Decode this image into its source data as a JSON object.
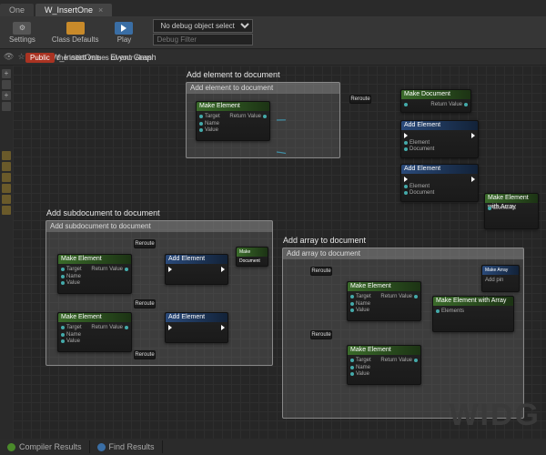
{
  "tabs": [
    {
      "label": "One",
      "active": false
    },
    {
      "label": "W_InsertOne",
      "active": true
    }
  ],
  "toolbar": {
    "settings_label": "Settings",
    "class_defaults_label": "Class Defaults",
    "play_label": "Play",
    "debug_object_placeholder": "No debug object selected",
    "debug_filter_placeholder": "Debug Filter"
  },
  "hint": {
    "button_label": "Public",
    "text": "the initial values of your class"
  },
  "breadcrumb": {
    "asset": "W_InsertOne",
    "graph": "Event Graph"
  },
  "comments": {
    "c1": {
      "title": "Add element to document",
      "bar": "Add element to document"
    },
    "c2": {
      "title": "Add subdocument to document",
      "bar": "Add subdocument to document"
    },
    "c3": {
      "title": "Add array to document",
      "bar": "Add array to document"
    }
  },
  "node_labels": {
    "make_document": "Make Document",
    "make_element": "Make Element",
    "make_element_with_array": "Make Element with Array",
    "add_element": "Add Element",
    "make_array": "Make Array"
  },
  "pins": {
    "target": "Target",
    "return_value": "Return Value",
    "name": "Name",
    "value": "Value",
    "element": "Element",
    "document": "Document",
    "elements": "Elements",
    "add_pin": "Add pin"
  },
  "reroute_label": "Reroute",
  "watermark": "WIDG",
  "footer": {
    "compiler_results": "Compiler Results",
    "find_results": "Find Results"
  }
}
